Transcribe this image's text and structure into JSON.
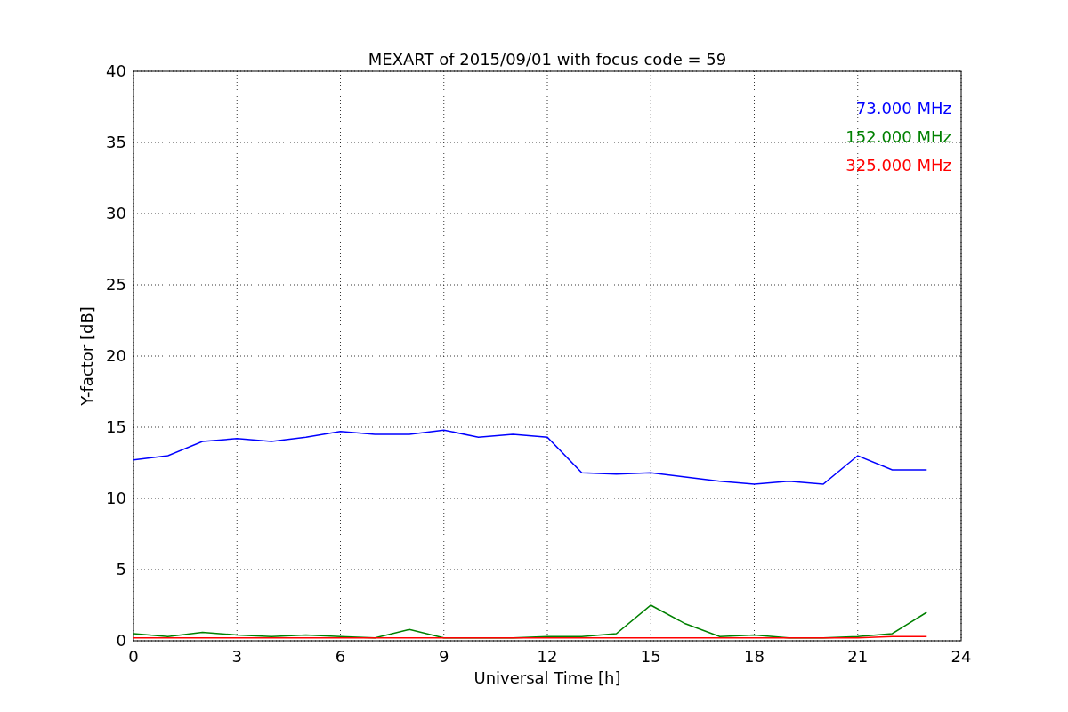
{
  "chart_data": {
    "type": "line",
    "title": "MEXART of 2015/09/01 with focus code = 59",
    "xlabel": "Universal Time [h]",
    "ylabel": "Y-factor [dB]",
    "x": [
      0,
      1,
      2,
      3,
      4,
      5,
      6,
      7,
      8,
      9,
      10,
      11,
      12,
      13,
      14,
      15,
      16,
      17,
      18,
      19,
      20,
      21,
      22,
      23
    ],
    "series": [
      {
        "name": "73.000 MHz",
        "color": "#0000ff",
        "values": [
          12.7,
          13,
          14,
          14.2,
          14,
          14.3,
          14.7,
          14.5,
          14.5,
          14.8,
          14.3,
          14.5,
          14.3,
          11.8,
          11.7,
          11.8,
          11.5,
          11.2,
          11,
          11.2,
          11,
          13,
          12,
          12
        ]
      },
      {
        "name": "152.000 MHz",
        "color": "#008000",
        "values": [
          0.5,
          0.3,
          0.6,
          0.4,
          0.3,
          0.4,
          0.3,
          0.2,
          0.8,
          0.2,
          0.2,
          0.2,
          0.3,
          0.3,
          0.5,
          2.5,
          1.2,
          0.3,
          0.4,
          0.2,
          0.2,
          0.3,
          0.5,
          2
        ]
      },
      {
        "name": "325.000 MHz",
        "color": "#ff0000",
        "values": [
          0.2,
          0.2,
          0.2,
          0.2,
          0.2,
          0.2,
          0.2,
          0.2,
          0.2,
          0.2,
          0.2,
          0.2,
          0.2,
          0.2,
          0.2,
          0.2,
          0.2,
          0.2,
          0.2,
          0.2,
          0.2,
          0.2,
          0.3,
          0.3
        ]
      }
    ],
    "xlim": [
      0,
      24
    ],
    "ylim": [
      0,
      40
    ],
    "xticks": [
      0,
      3,
      6,
      9,
      12,
      15,
      18,
      21,
      24
    ],
    "yticks": [
      0,
      5,
      10,
      15,
      20,
      25,
      30,
      35,
      40
    ],
    "grid": true
  }
}
